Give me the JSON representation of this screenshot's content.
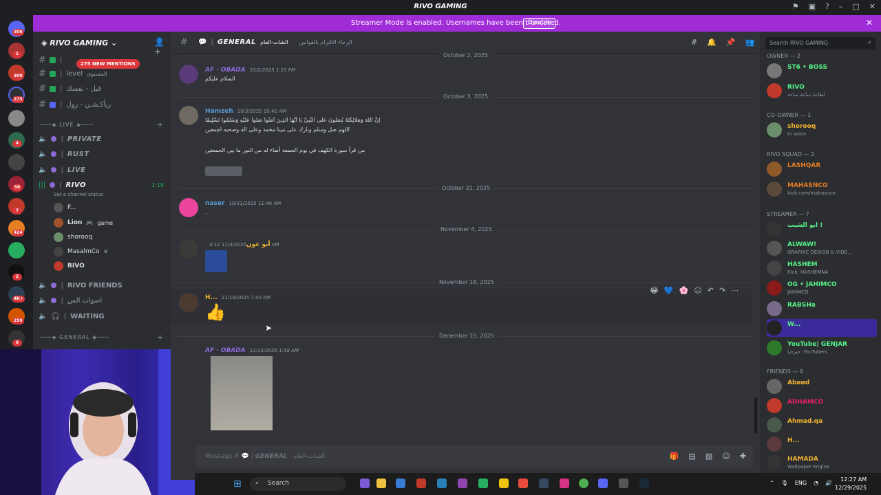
{
  "window": {
    "title": "RIVO GAMING"
  },
  "banner": {
    "message": "Streamer Mode is enabled. Usernames have been truncated.",
    "button": "Disable"
  },
  "rail": {
    "badges": [
      "306",
      "1",
      "300",
      "275",
      "4",
      "58",
      "7",
      "424",
      "2",
      "4K+",
      "259",
      "6"
    ]
  },
  "sidebar": {
    "guild_name": "RIVO GAMING",
    "mentions_badge": "275 NEW MENTIONS",
    "text_channels": [
      {
        "name": "level",
        "suffix": "المستوى"
      },
      {
        "name": "قبل - نفسك",
        "suffix": ""
      },
      {
        "name": "ريأكـشـن - رول",
        "suffix": ""
      }
    ],
    "live_category": "LIVE",
    "voice_channels": [
      "PRIVATE",
      "RUST",
      "LIVE",
      "RIVO"
    ],
    "voice_time": "2:18",
    "channel_status": "Set a channel status",
    "voice_users": [
      {
        "name": "F..."
      },
      {
        "name": "Lion",
        "extra": "game"
      },
      {
        "name": "shorooq"
      },
      {
        "name": "MasalmCo"
      },
      {
        "name": "RIVO"
      }
    ],
    "more_voice": [
      "RIVO FRIENDS",
      "اصوات الس",
      "WAITING"
    ],
    "general_category": "GENERAL",
    "general_channel": "GENERAL"
  },
  "chat": {
    "channel_name": "GENERAL",
    "channel_ar": "الشات-العام",
    "topic": "الرجاء الالتزام بالقوانين",
    "messages": [
      {
        "date": "October 2, 2025",
        "author": "AF · OBADA",
        "time": "10/2/2025 1:21 PM",
        "text": "السلام عليكم"
      },
      {
        "date": "October 3, 2025",
        "author": "Hamzeh",
        "time": "10/3/2025 10:41 AM",
        "text": "إِنَّ اللَّهَ وَمَلَائِكَتَهُ يُصَلُّونَ عَلَى النَّبِيِّ يَا أَيُّهَا الَّذِينَ آمَنُوا صَلُّوا عَلَيْهِ وَسَلِّمُوا تَسْلِيمًا",
        "text2": "اللهم صل وسلم وبارك على نبينا محمد وعلى اله وصحبه اجمعين",
        "text3": "من قرأ سورة الكهف في يوم الجمعة أضاء له من النور ما بين الجمعتين"
      },
      {
        "date": "October 31, 2025",
        "author": "naser",
        "time": "10/31/2025 11:40 AM",
        "text": "."
      },
      {
        "date": "November 4, 2025",
        "author": "أبو عون",
        "time": "11/4/2025 3:12 AM"
      },
      {
        "date": "November 18, 2025",
        "author": "H...",
        "time": "11/18/2025 7:40 AM"
      },
      {
        "date": "December 15, 2025",
        "author": "AF · OBADA",
        "time": "12/15/2025 1:58 AM"
      }
    ],
    "composer_placeholder": "Message #"
  },
  "members": {
    "search_placeholder": "Search RIVO GAMING",
    "groups": [
      {
        "title": "OWNER — 2",
        "items": [
          {
            "name": "ST6 • BOSS",
            "status": "",
            "color": "#23a55a"
          },
          {
            "name": "RIVO",
            "status": "لطاعة ساعة ساعة",
            "color": "#23a55a"
          }
        ]
      },
      {
        "title": "CO-OWNER — 1",
        "items": [
          {
            "name": "shorooq",
            "status": "In voice",
            "color": "#f0b232"
          }
        ]
      },
      {
        "title": "RIVO SQUAD — 2",
        "items": [
          {
            "name": "LASHQAR",
            "status": "",
            "color": "#e67e22"
          },
          {
            "name": "MAHASNCO",
            "status": "kick.com/mahasnco",
            "color": "#e67e22"
          }
        ]
      },
      {
        "title": "STREAMER — 7",
        "items": [
          {
            "name": "ابو الشيب !",
            "status": "",
            "color": "#23a55a"
          },
          {
            "name": "ALWAW!",
            "status": "GRAPHIC DESIGN & VIDE...",
            "color": "#23a55a"
          },
          {
            "name": "HASHEM",
            "status": "Kick: HASHEMNA",
            "color": "#23a55a"
          },
          {
            "name": "OG • JAHIMCO",
            "status": "JAHIMCO",
            "color": "#23a55a"
          },
          {
            "name": "RABSHa",
            "status": "",
            "color": "#23a55a"
          },
          {
            "name": "W...",
            "status": "",
            "color": "#23a55a"
          },
          {
            "name": "YouTube| GENJAR",
            "status": "جيرجيا :YouTubers",
            "color": "#23a55a"
          }
        ]
      },
      {
        "title": "FRIENDS — 8",
        "items": [
          {
            "name": "Abøød",
            "status": "",
            "color": "#f0b232"
          },
          {
            "name": "ADHAMCO",
            "status": "",
            "color": "#e91e63"
          },
          {
            "name": "Ahmad.qa",
            "status": "",
            "color": "#f0b232"
          },
          {
            "name": "H...",
            "status": "",
            "color": "#f0b232"
          },
          {
            "name": "HAMADA",
            "status": "Wallpaper Engine",
            "color": "#f0b232"
          }
        ]
      }
    ]
  },
  "taskbar": {
    "search": "Search",
    "lang": "ENG",
    "time": "12:27 AM",
    "date": "12/29/2025"
  }
}
